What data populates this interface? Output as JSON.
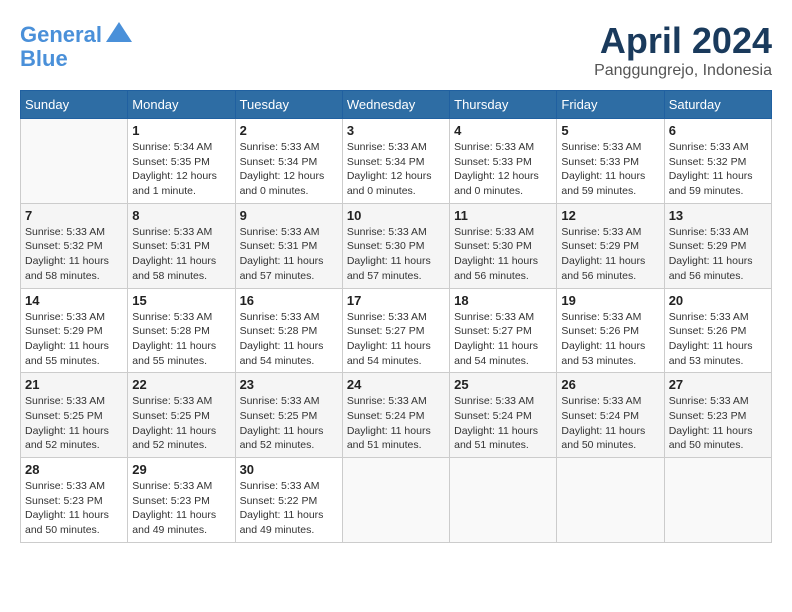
{
  "header": {
    "logo_line1": "General",
    "logo_line2": "Blue",
    "month": "April 2024",
    "location": "Panggungrejo, Indonesia"
  },
  "days_of_week": [
    "Sunday",
    "Monday",
    "Tuesday",
    "Wednesday",
    "Thursday",
    "Friday",
    "Saturday"
  ],
  "weeks": [
    [
      {
        "num": "",
        "sunrise": "",
        "sunset": "",
        "daylight": "",
        "empty": true
      },
      {
        "num": "1",
        "sunrise": "Sunrise: 5:34 AM",
        "sunset": "Sunset: 5:35 PM",
        "daylight": "Daylight: 12 hours and 1 minute."
      },
      {
        "num": "2",
        "sunrise": "Sunrise: 5:33 AM",
        "sunset": "Sunset: 5:34 PM",
        "daylight": "Daylight: 12 hours and 0 minutes."
      },
      {
        "num": "3",
        "sunrise": "Sunrise: 5:33 AM",
        "sunset": "Sunset: 5:34 PM",
        "daylight": "Daylight: 12 hours and 0 minutes."
      },
      {
        "num": "4",
        "sunrise": "Sunrise: 5:33 AM",
        "sunset": "Sunset: 5:33 PM",
        "daylight": "Daylight: 12 hours and 0 minutes."
      },
      {
        "num": "5",
        "sunrise": "Sunrise: 5:33 AM",
        "sunset": "Sunset: 5:33 PM",
        "daylight": "Daylight: 11 hours and 59 minutes."
      },
      {
        "num": "6",
        "sunrise": "Sunrise: 5:33 AM",
        "sunset": "Sunset: 5:32 PM",
        "daylight": "Daylight: 11 hours and 59 minutes."
      }
    ],
    [
      {
        "num": "7",
        "sunrise": "Sunrise: 5:33 AM",
        "sunset": "Sunset: 5:32 PM",
        "daylight": "Daylight: 11 hours and 58 minutes."
      },
      {
        "num": "8",
        "sunrise": "Sunrise: 5:33 AM",
        "sunset": "Sunset: 5:31 PM",
        "daylight": "Daylight: 11 hours and 58 minutes."
      },
      {
        "num": "9",
        "sunrise": "Sunrise: 5:33 AM",
        "sunset": "Sunset: 5:31 PM",
        "daylight": "Daylight: 11 hours and 57 minutes."
      },
      {
        "num": "10",
        "sunrise": "Sunrise: 5:33 AM",
        "sunset": "Sunset: 5:30 PM",
        "daylight": "Daylight: 11 hours and 57 minutes."
      },
      {
        "num": "11",
        "sunrise": "Sunrise: 5:33 AM",
        "sunset": "Sunset: 5:30 PM",
        "daylight": "Daylight: 11 hours and 56 minutes."
      },
      {
        "num": "12",
        "sunrise": "Sunrise: 5:33 AM",
        "sunset": "Sunset: 5:29 PM",
        "daylight": "Daylight: 11 hours and 56 minutes."
      },
      {
        "num": "13",
        "sunrise": "Sunrise: 5:33 AM",
        "sunset": "Sunset: 5:29 PM",
        "daylight": "Daylight: 11 hours and 56 minutes."
      }
    ],
    [
      {
        "num": "14",
        "sunrise": "Sunrise: 5:33 AM",
        "sunset": "Sunset: 5:29 PM",
        "daylight": "Daylight: 11 hours and 55 minutes."
      },
      {
        "num": "15",
        "sunrise": "Sunrise: 5:33 AM",
        "sunset": "Sunset: 5:28 PM",
        "daylight": "Daylight: 11 hours and 55 minutes."
      },
      {
        "num": "16",
        "sunrise": "Sunrise: 5:33 AM",
        "sunset": "Sunset: 5:28 PM",
        "daylight": "Daylight: 11 hours and 54 minutes."
      },
      {
        "num": "17",
        "sunrise": "Sunrise: 5:33 AM",
        "sunset": "Sunset: 5:27 PM",
        "daylight": "Daylight: 11 hours and 54 minutes."
      },
      {
        "num": "18",
        "sunrise": "Sunrise: 5:33 AM",
        "sunset": "Sunset: 5:27 PM",
        "daylight": "Daylight: 11 hours and 54 minutes."
      },
      {
        "num": "19",
        "sunrise": "Sunrise: 5:33 AM",
        "sunset": "Sunset: 5:26 PM",
        "daylight": "Daylight: 11 hours and 53 minutes."
      },
      {
        "num": "20",
        "sunrise": "Sunrise: 5:33 AM",
        "sunset": "Sunset: 5:26 PM",
        "daylight": "Daylight: 11 hours and 53 minutes."
      }
    ],
    [
      {
        "num": "21",
        "sunrise": "Sunrise: 5:33 AM",
        "sunset": "Sunset: 5:25 PM",
        "daylight": "Daylight: 11 hours and 52 minutes."
      },
      {
        "num": "22",
        "sunrise": "Sunrise: 5:33 AM",
        "sunset": "Sunset: 5:25 PM",
        "daylight": "Daylight: 11 hours and 52 minutes."
      },
      {
        "num": "23",
        "sunrise": "Sunrise: 5:33 AM",
        "sunset": "Sunset: 5:25 PM",
        "daylight": "Daylight: 11 hours and 52 minutes."
      },
      {
        "num": "24",
        "sunrise": "Sunrise: 5:33 AM",
        "sunset": "Sunset: 5:24 PM",
        "daylight": "Daylight: 11 hours and 51 minutes."
      },
      {
        "num": "25",
        "sunrise": "Sunrise: 5:33 AM",
        "sunset": "Sunset: 5:24 PM",
        "daylight": "Daylight: 11 hours and 51 minutes."
      },
      {
        "num": "26",
        "sunrise": "Sunrise: 5:33 AM",
        "sunset": "Sunset: 5:24 PM",
        "daylight": "Daylight: 11 hours and 50 minutes."
      },
      {
        "num": "27",
        "sunrise": "Sunrise: 5:33 AM",
        "sunset": "Sunset: 5:23 PM",
        "daylight": "Daylight: 11 hours and 50 minutes."
      }
    ],
    [
      {
        "num": "28",
        "sunrise": "Sunrise: 5:33 AM",
        "sunset": "Sunset: 5:23 PM",
        "daylight": "Daylight: 11 hours and 50 minutes."
      },
      {
        "num": "29",
        "sunrise": "Sunrise: 5:33 AM",
        "sunset": "Sunset: 5:23 PM",
        "daylight": "Daylight: 11 hours and 49 minutes."
      },
      {
        "num": "30",
        "sunrise": "Sunrise: 5:33 AM",
        "sunset": "Sunset: 5:22 PM",
        "daylight": "Daylight: 11 hours and 49 minutes."
      },
      {
        "num": "",
        "sunrise": "",
        "sunset": "",
        "daylight": "",
        "empty": true
      },
      {
        "num": "",
        "sunrise": "",
        "sunset": "",
        "daylight": "",
        "empty": true
      },
      {
        "num": "",
        "sunrise": "",
        "sunset": "",
        "daylight": "",
        "empty": true
      },
      {
        "num": "",
        "sunrise": "",
        "sunset": "",
        "daylight": "",
        "empty": true
      }
    ]
  ]
}
